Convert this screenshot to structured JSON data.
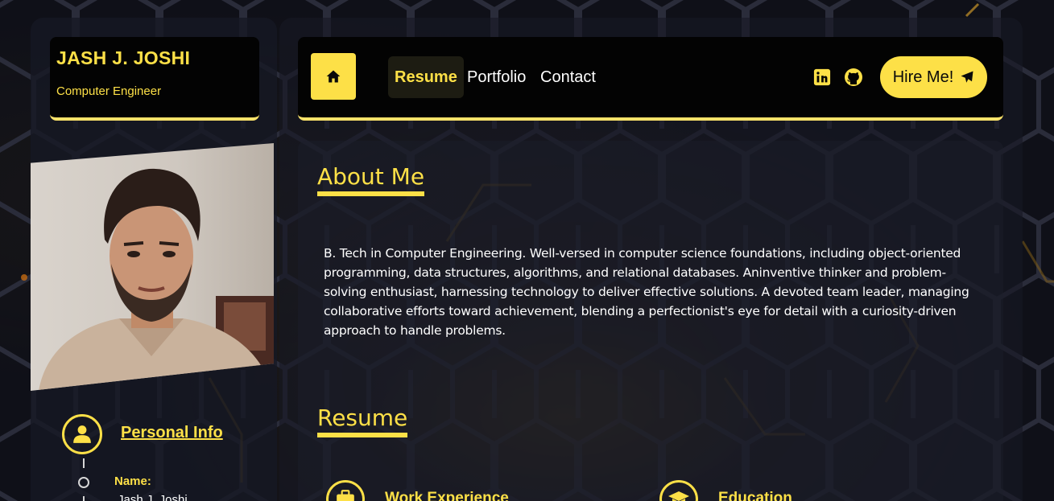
{
  "sidebar": {
    "name": "JASH J. JOSHI",
    "role": "Computer Engineer",
    "photo_icon": "profile-photo",
    "personal_info_link": "Personal Info",
    "personal_info_icon": "user-icon",
    "name_label": "Name:",
    "name_value": "Jash J. Joshi"
  },
  "nav": {
    "home_icon": "home-icon",
    "items": [
      {
        "label": "Resume",
        "active": true
      },
      {
        "label": "Portfolio",
        "active": false
      },
      {
        "label": "Contact",
        "active": false
      }
    ],
    "social_icons": [
      "linkedin-icon",
      "github-icon"
    ],
    "hire_label": "Hire Me!",
    "hire_icon": "paper-plane-icon"
  },
  "about": {
    "title": "About Me",
    "text": "B. Tech in Computer Engineering. Well-versed in computer science foundations, including object-oriented programming, data structures, algorithms, and relational databases. Aninventive thinker and problem-solving enthusiast, harnessing technology to deliver effective solutions. A devoted team leader, managing collaborative efforts toward achievement, blending a perfectionist's eye for detail with a curiosity-driven approach to handle problems."
  },
  "resume": {
    "title": "Resume",
    "sections": [
      {
        "label": "Work Experience",
        "icon": "briefcase-icon"
      },
      {
        "label": "Education",
        "icon": "graduation-cap-icon"
      }
    ]
  },
  "colors": {
    "accent": "#fde047",
    "background": "#0f1018",
    "card": "#030303"
  }
}
